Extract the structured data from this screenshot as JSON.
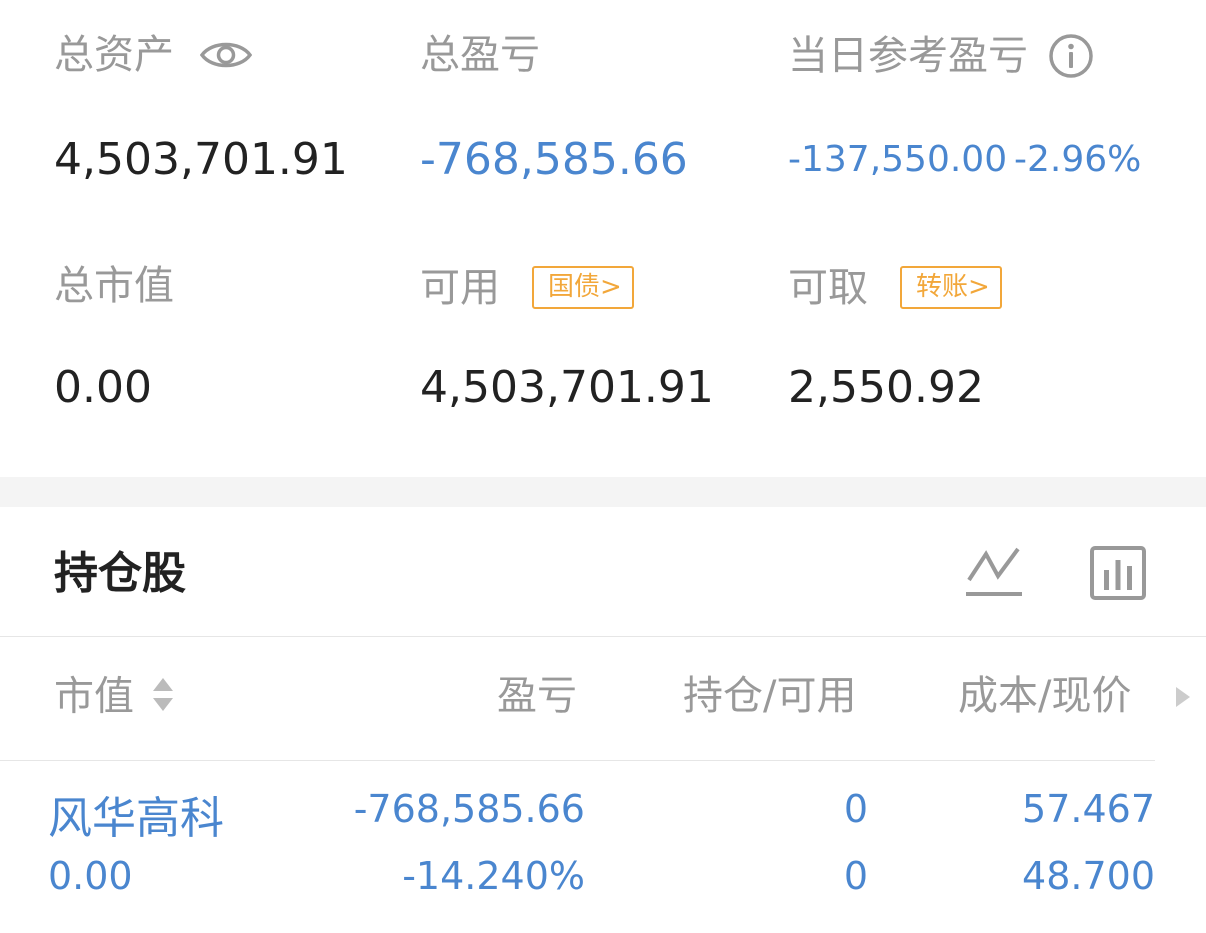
{
  "summary": {
    "total_assets_label": "总资产",
    "total_assets_value": "4,503,701.91",
    "total_pnl_label": "总盈亏",
    "total_pnl_value": "-768,585.66",
    "daily_pnl_label": "当日参考盈亏",
    "daily_pnl_value": "-137,550.00",
    "daily_pnl_pct": "-2.96%",
    "market_value_label": "总市值",
    "market_value_value": "0.00",
    "available_label": "可用",
    "available_tag": "国债>",
    "available_value": "4,503,701.91",
    "withdrawable_label": "可取",
    "withdrawable_tag": "转账>",
    "withdrawable_value": "2,550.92"
  },
  "holdings": {
    "title": "持仓股",
    "columns": {
      "market_value": "市值",
      "pnl": "盈亏",
      "position": "持仓/可用",
      "cost_price": "成本/现价"
    },
    "rows": [
      {
        "name": "风华高科",
        "market_value": "0.00",
        "pnl": "-768,585.66",
        "pnl_pct": "-14.240%",
        "position": "0",
        "available": "0",
        "cost": "57.467",
        "price": "48.700"
      }
    ]
  },
  "icons": {
    "eye": "eye-icon",
    "info": "info-icon",
    "line_chart": "line-chart-icon",
    "bar_chart": "bar-chart-icon",
    "sort": "sort-icon",
    "scroll_right": "triangle-right-icon"
  },
  "colors": {
    "loss_blue": "#4a86cf",
    "tag_orange": "#f2a73a",
    "label_gray": "#999999",
    "text_dark": "#222222"
  }
}
